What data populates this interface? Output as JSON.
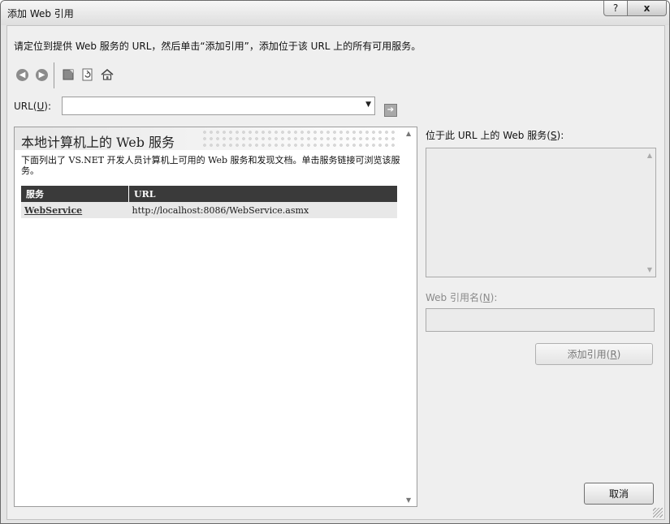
{
  "window": {
    "title": "添加 Web 引用",
    "help_glyph": "?",
    "close_glyph": "x"
  },
  "instruction": "请定位到提供 Web 服务的 URL，然后单击“添加引用”，添加位于该 URL 上的所有可用服务。",
  "toolbar": {
    "back_icon": "back-arrow-icon",
    "forward_icon": "forward-arrow-icon",
    "stop_icon": "stop-icon",
    "refresh_icon": "refresh-icon",
    "home_icon": "home-icon"
  },
  "url": {
    "label": "URL(",
    "accel": "U",
    "label_end": "):",
    "value": ""
  },
  "left_panel": {
    "title": "本地计算机上的 Web 服务",
    "description": "下面列出了 VS.NET 开发人员计算机上可用的 Web 服务和发现文档。单击服务链接可浏览该服务。",
    "table": {
      "headers": [
        "服务",
        "URL"
      ],
      "rows": [
        {
          "service": "WebService",
          "url": "http://localhost:8086/WebService.asmx"
        }
      ]
    }
  },
  "right_panel": {
    "services_label": "位于此 URL 上的 Web 服务(",
    "services_accel": "S",
    "services_label_end": "):",
    "ref_name_label": "Web 引用名(",
    "ref_name_accel": "N",
    "ref_name_label_end": "):",
    "ref_name_value": ""
  },
  "buttons": {
    "add_reference": "添加引用(",
    "add_reference_accel": "R",
    "add_reference_end": ")",
    "cancel": "取消"
  },
  "colors": {
    "table_header_bg": "#3a3a3a",
    "disabled_text": "#8a8a8a"
  }
}
